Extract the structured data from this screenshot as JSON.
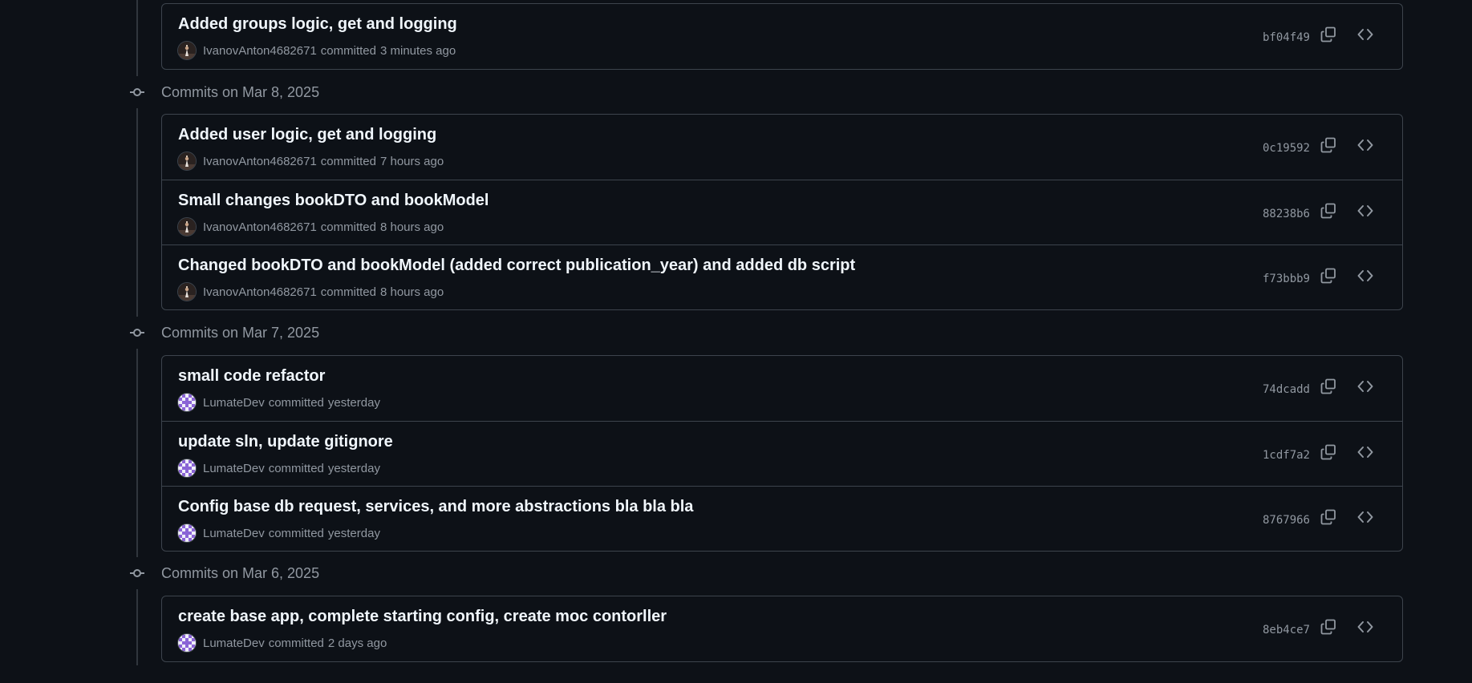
{
  "colors": {
    "background": "#0d1117",
    "border": "#3d444d",
    "text_primary": "#f0f6fc",
    "text_muted": "#9198a1"
  },
  "groups": [
    {
      "label": "",
      "commits": [
        {
          "title": "Added groups logic, get and logging",
          "author": "IvanovAnton4682671",
          "action": "committed",
          "time": "3 minutes ago",
          "sha": "bf04f49",
          "avatar": "ivanov-avatar"
        }
      ]
    },
    {
      "label": "Commits on Mar 8, 2025",
      "commits": [
        {
          "title": "Added user logic, get and logging",
          "author": "IvanovAnton4682671",
          "action": "committed",
          "time": "7 hours ago",
          "sha": "0c19592",
          "avatar": "ivanov-avatar"
        },
        {
          "title": "Small changes bookDTO and bookModel",
          "author": "IvanovAnton4682671",
          "action": "committed",
          "time": "8 hours ago",
          "sha": "88238b6",
          "avatar": "ivanov-avatar"
        },
        {
          "title": "Changed bookDTO and bookModel (added correct publication_year) and added db script",
          "author": "IvanovAnton4682671",
          "action": "committed",
          "time": "8 hours ago",
          "sha": "f73bbb9",
          "avatar": "ivanov-avatar"
        }
      ]
    },
    {
      "label": "Commits on Mar 7, 2025",
      "commits": [
        {
          "title": "small code refactor",
          "author": "LumateDev",
          "action": "committed",
          "time": "yesterday",
          "sha": "74dcadd",
          "avatar": "lumate-avatar"
        },
        {
          "title": "update sln, update gitignore",
          "author": "LumateDev",
          "action": "committed",
          "time": "yesterday",
          "sha": "1cdf7a2",
          "avatar": "lumate-avatar"
        },
        {
          "title": "Config base db request, services, and more abstractions bla bla bla",
          "author": "LumateDev",
          "action": "committed",
          "time": "yesterday",
          "sha": "8767966",
          "avatar": "lumate-avatar"
        }
      ]
    },
    {
      "label": "Commits on Mar 6, 2025",
      "commits": [
        {
          "title": "create base app, complete starting config, create moc contorller",
          "author": "LumateDev",
          "action": "committed",
          "time": "2 days ago",
          "sha": "8eb4ce7",
          "avatar": "lumate-avatar"
        }
      ]
    }
  ]
}
